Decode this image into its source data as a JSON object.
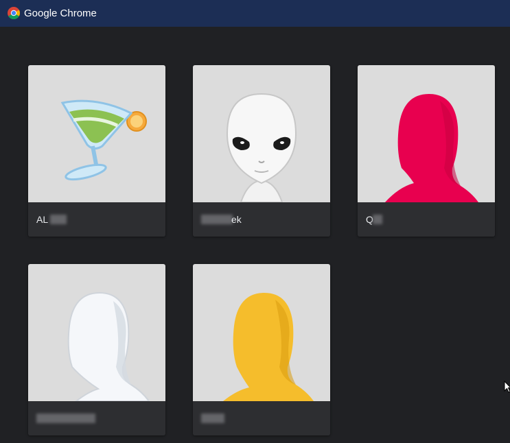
{
  "window": {
    "title": "Google Chrome",
    "icon": "chrome-icon"
  },
  "profiles": [
    {
      "name": "AL",
      "avatar": "cocktail-avatar-icon",
      "name_obscured": true
    },
    {
      "name": "ek",
      "avatar": "alien-avatar-icon",
      "name_obscured": true
    },
    {
      "name": "Q",
      "avatar": "red-silhouette-avatar-icon",
      "name_obscured": true
    },
    {
      "name": "",
      "avatar": "white-silhouette-avatar-icon",
      "name_obscured": true
    },
    {
      "name": "",
      "avatar": "yellow-silhouette-avatar-icon",
      "name_obscured": true
    }
  ],
  "colors": {
    "titlebar": "#1c2e55",
    "background": "#202124",
    "card": "#2d2e31",
    "avatar_bg": "#dcdcdc",
    "red_silhouette": "#e8004f",
    "yellow_silhouette": "#f5bd2c",
    "white_silhouette": "#f5f7fa"
  }
}
